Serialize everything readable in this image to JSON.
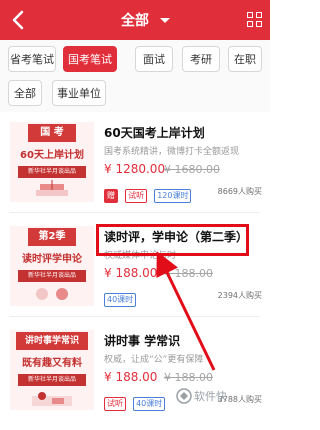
{
  "header": {
    "title": "全部",
    "back_icon": "chevron-left-icon",
    "menu_icon": "grid-icon"
  },
  "filters": {
    "row1": [
      "省考笔试",
      "国考笔试",
      "面试",
      "考研",
      "在职"
    ],
    "row2": [
      "全部",
      "事业单位"
    ],
    "active": "国考笔试"
  },
  "items": [
    {
      "title": "60天国考上岸计划",
      "subtitle": "国考系统精讲，微博打卡全额返现",
      "price": "¥ 1280.00",
      "old_price": "¥ 1680.00",
      "tags": [
        "赠",
        "试听",
        "120课时"
      ],
      "buyers": "8669人购买",
      "thumb": {
        "band": "国 考",
        "headline": "60天上岸计划",
        "tagline": "新华社半月谈出品"
      }
    },
    {
      "title": "读时评，学申论（第二季）",
      "subtitle": "权威媒体申论与时",
      "price": "¥ 188.00",
      "old_price": "¥ 188.00",
      "tags": [
        "40课时"
      ],
      "buyers": "2394人购买",
      "thumb": {
        "band": "第2季",
        "headline": "读时评学申论",
        "tagline": "新华社半月谈出品"
      }
    },
    {
      "title": "讲时事 学常识",
      "subtitle": "权威，让成“公”更有保障",
      "price": "¥ 188.00",
      "old_price": "¥ 188.00",
      "tags": [
        "试听",
        "40课时"
      ],
      "buyers": "3788人购买",
      "thumb": {
        "band": "讲时事学常识",
        "headline": "既有趣又有料",
        "tagline": "新华社半月谈出品"
      }
    }
  ],
  "watermark": "软件快",
  "colors": {
    "brand": "#e12e3b",
    "blue_tag": "#4a80d9",
    "highlight": "#e10d18"
  }
}
